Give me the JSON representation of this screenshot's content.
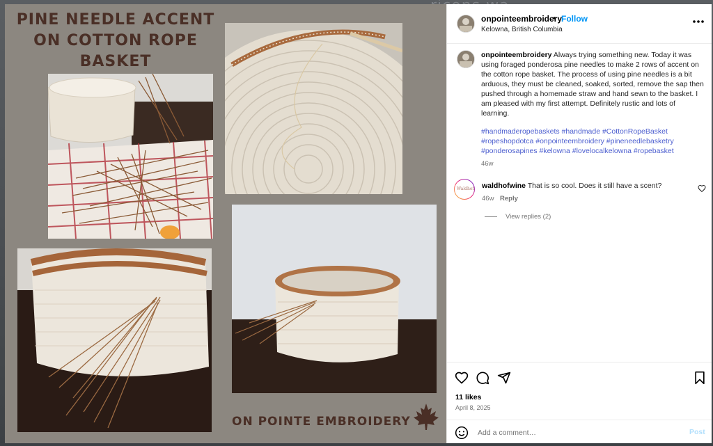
{
  "backdrop": {
    "text": "ricons wa"
  },
  "image": {
    "title": "PINE NEEDLE ACCENT\nON COTTON ROPE\nBASKET",
    "footer": "ON POINTE EMBROIDERY",
    "photos": [
      "basket-with-pine-needles-on-towel",
      "basket-interior-spiral",
      "basket-side-closeup",
      "finished-basket-on-table"
    ]
  },
  "header": {
    "username": "onpointeembroidery",
    "separator": "•",
    "follow_label": "Follow",
    "location": "Kelowna, British Columbia",
    "more_icon": "more-horizontal-icon"
  },
  "caption": {
    "username": "onpointeembroidery",
    "text": "Always trying something new. Today it was using foraged ponderosa pine needles to make 2 rows of accent on the cotton rope basket. The process of using pine needles is a bit arduous, they must be cleaned, soaked, sorted, remove the sap then pushed through a homemade straw and hand sewn to the basket. I am pleased with my first attempt. Definitely rustic and lots of learning.",
    "hashtags": "#handmaderopebaskets #handmade #CottonRopeBasket #ropeshopdotca #onpointeembroidery #pineneedlebasketry #ponderosapines #kelowna #lovelocalkelowna #ropebasket",
    "time": "46w"
  },
  "comment": {
    "username": "waldhofwine",
    "avatar_text": "Waldhof",
    "text": "That is so cool. Does it still have a scent?",
    "time": "46w",
    "reply_label": "Reply",
    "view_replies": "View replies (2)"
  },
  "actions": {
    "likes": "11 likes",
    "date": "April 8, 2025"
  },
  "add_comment": {
    "placeholder": "Add a comment…",
    "post_label": "Post"
  },
  "colors": {
    "accent": "#0095f6",
    "hashtag": "#4c5ecf",
    "image_bg": "#8c8780",
    "title_brown": "#4a2f26"
  }
}
